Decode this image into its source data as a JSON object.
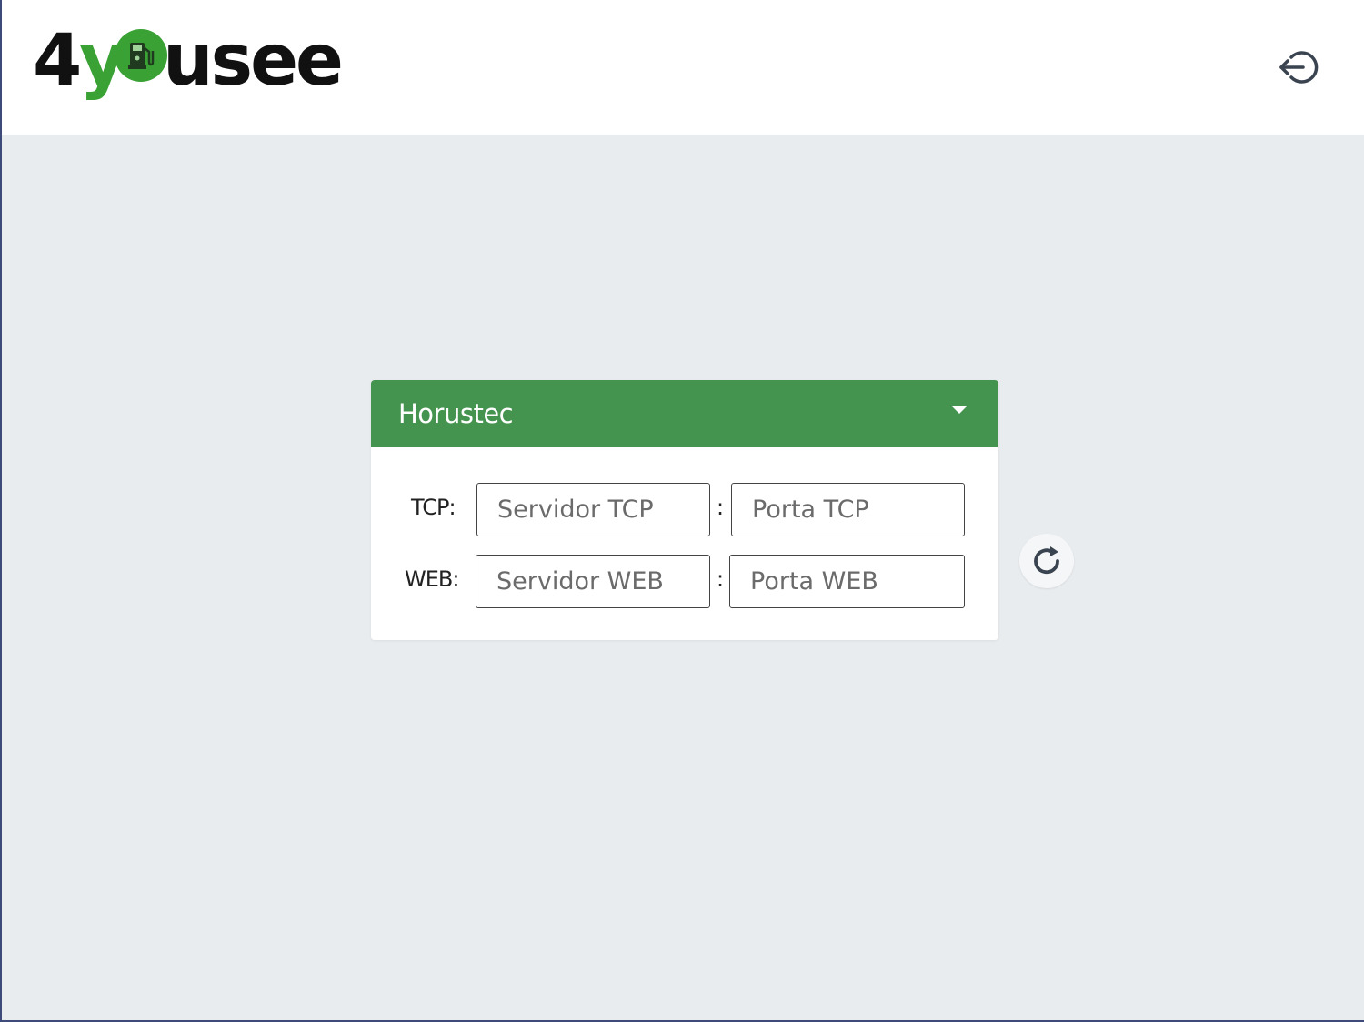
{
  "header": {
    "logo": {
      "text_part1": "4",
      "text_part2": "y",
      "text_part3": "usee",
      "alt": "4yousee"
    },
    "logout_icon": "logout-icon"
  },
  "panel": {
    "title": "Horustec",
    "toggle_icon": "caret-down-icon",
    "rows": [
      {
        "label": "TCP:",
        "server_placeholder": "Servidor TCP",
        "server_value": "",
        "separator": ":",
        "port_placeholder": "Porta TCP",
        "port_value": ""
      },
      {
        "label": "WEB:",
        "server_placeholder": "Servidor WEB",
        "server_value": "",
        "separator": ":",
        "port_placeholder": "Porta WEB",
        "port_value": ""
      }
    ]
  },
  "actions": {
    "refresh_icon": "refresh-icon"
  },
  "colors": {
    "brand_green": "#44944f",
    "logo_green": "#3aa235",
    "background": "#e9ecef",
    "header_bg": "#ffffff"
  }
}
